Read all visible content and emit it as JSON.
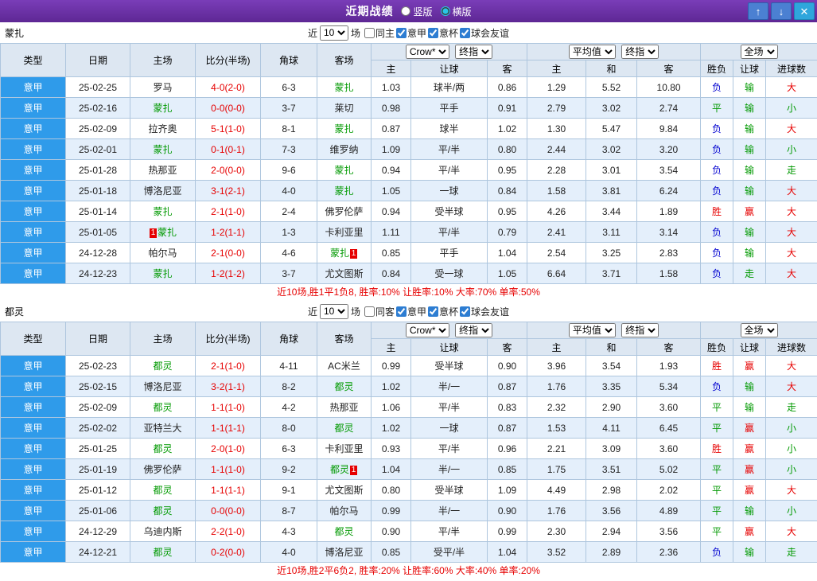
{
  "titlebar": {
    "title": "近期战绩",
    "layout_options": [
      {
        "label": "竖版",
        "selected": false
      },
      {
        "label": "横版",
        "selected": true
      }
    ],
    "up_icon": "↑",
    "down_icon": "↓",
    "close_icon": "✕"
  },
  "dropdowns": {
    "company": "Crow*",
    "final": "终指",
    "average": "平均值",
    "scope": "全场"
  },
  "filter_labels": {
    "near": "近",
    "games": "场"
  },
  "columns": {
    "type": "类型",
    "date": "日期",
    "home": "主场",
    "score": "比分(半场)",
    "corner": "角球",
    "away": "客场",
    "h": "主",
    "handicap": "让球",
    "a": "客",
    "h2": "主",
    "d": "和",
    "a2": "客",
    "result": "胜负",
    "rq": "让球",
    "goals": "进球数"
  },
  "result_color_map": {
    "胜": "red",
    "赢": "red",
    "大": "red",
    "平": "green",
    "输": "green",
    "小": "green",
    "走": "green",
    "负": "blue"
  },
  "colors": {
    "accent_blue": "#2f9bea",
    "title_purple": "#6a2fa9",
    "positive_red": "#e60000",
    "negative_green": "#009900",
    "draw_blue": "#0000d0"
  },
  "sections": [
    {
      "team": "蒙扎",
      "filter": {
        "count": "10",
        "checkboxes": [
          {
            "label": "同主",
            "checked": false
          },
          {
            "label": "意甲",
            "checked": true
          },
          {
            "label": "意杯",
            "checked": true
          },
          {
            "label": "球会友谊",
            "checked": true
          }
        ]
      },
      "rows": [
        {
          "league": "意甲",
          "date": "25-02-25",
          "home": "罗马",
          "score": "4-0(2-0)",
          "corner": "6-3",
          "away": "蒙扎",
          "away_team": true,
          "o1": "1.03",
          "handicap": "球半/两",
          "o2": "0.86",
          "e1": "1.29",
          "e2": "5.52",
          "e3": "10.80",
          "r1": "负",
          "r2": "输",
          "r3": "大"
        },
        {
          "league": "意甲",
          "date": "25-02-16",
          "home": "蒙扎",
          "home_team": true,
          "score": "0-0(0-0)",
          "corner": "3-7",
          "away": "莱切",
          "o1": "0.98",
          "handicap": "平手",
          "o2": "0.91",
          "e1": "2.79",
          "e2": "3.02",
          "e3": "2.74",
          "r1": "平",
          "r2": "输",
          "r3": "小"
        },
        {
          "league": "意甲",
          "date": "25-02-09",
          "home": "拉齐奥",
          "score": "5-1(1-0)",
          "corner": "8-1",
          "away": "蒙扎",
          "away_team": true,
          "o1": "0.87",
          "handicap": "球半",
          "o2": "1.02",
          "e1": "1.30",
          "e2": "5.47",
          "e3": "9.84",
          "r1": "负",
          "r2": "输",
          "r3": "大"
        },
        {
          "league": "意甲",
          "date": "25-02-01",
          "home": "蒙扎",
          "home_team": true,
          "score": "0-1(0-1)",
          "corner": "7-3",
          "away": "维罗纳",
          "o1": "1.09",
          "handicap": "平/半",
          "o2": "0.80",
          "e1": "2.44",
          "e2": "3.02",
          "e3": "3.20",
          "r1": "负",
          "r2": "输",
          "r3": "小"
        },
        {
          "league": "意甲",
          "date": "25-01-28",
          "home": "热那亚",
          "score": "2-0(0-0)",
          "corner": "9-6",
          "away": "蒙扎",
          "away_team": true,
          "o1": "0.94",
          "handicap": "平/半",
          "o2": "0.95",
          "e1": "2.28",
          "e2": "3.01",
          "e3": "3.54",
          "r1": "负",
          "r2": "输",
          "r3": "走"
        },
        {
          "league": "意甲",
          "date": "25-01-18",
          "home": "博洛尼亚",
          "score": "3-1(2-1)",
          "corner": "4-0",
          "away": "蒙扎",
          "away_team": true,
          "o1": "1.05",
          "handicap": "一球",
          "o2": "0.84",
          "e1": "1.58",
          "e2": "3.81",
          "e3": "6.24",
          "r1": "负",
          "r2": "输",
          "r3": "大"
        },
        {
          "league": "意甲",
          "date": "25-01-14",
          "home": "蒙扎",
          "home_team": true,
          "score": "2-1(1-0)",
          "corner": "2-4",
          "away": "佛罗伦萨",
          "o1": "0.94",
          "handicap": "受半球",
          "o2": "0.95",
          "e1": "4.26",
          "e2": "3.44",
          "e3": "1.89",
          "r1": "胜",
          "r2": "赢",
          "r3": "大"
        },
        {
          "league": "意甲",
          "date": "25-01-05",
          "home": "蒙扎",
          "home_team": true,
          "home_card": "1",
          "home_card_side": "left",
          "score": "1-2(1-1)",
          "corner": "1-3",
          "away": "卡利亚里",
          "o1": "1.11",
          "handicap": "平/半",
          "o2": "0.79",
          "e1": "2.41",
          "e2": "3.11",
          "e3": "3.14",
          "r1": "负",
          "r2": "输",
          "r3": "大"
        },
        {
          "league": "意甲",
          "date": "24-12-28",
          "home": "帕尔马",
          "score": "2-1(0-0)",
          "corner": "4-6",
          "away": "蒙扎",
          "away_team": true,
          "away_card": "1",
          "away_card_side": "right",
          "o1": "0.85",
          "handicap": "平手",
          "o2": "1.04",
          "e1": "2.54",
          "e2": "3.25",
          "e3": "2.83",
          "r1": "负",
          "r2": "输",
          "r3": "大"
        },
        {
          "league": "意甲",
          "date": "24-12-23",
          "home": "蒙扎",
          "home_team": true,
          "score": "1-2(1-2)",
          "corner": "3-7",
          "away": "尤文图斯",
          "o1": "0.84",
          "handicap": "受一球",
          "o2": "1.05",
          "e1": "6.64",
          "e2": "3.71",
          "e3": "1.58",
          "r1": "负",
          "r2": "走",
          "r3": "大"
        }
      ],
      "summary": "近10场,胜1平1负8, 胜率:10% 让胜率:10% 大率:70% 单率:50%"
    },
    {
      "team": "都灵",
      "filter": {
        "count": "10",
        "checkboxes": [
          {
            "label": "同客",
            "checked": false
          },
          {
            "label": "意甲",
            "checked": true
          },
          {
            "label": "意杯",
            "checked": true
          },
          {
            "label": "球会友谊",
            "checked": true
          }
        ]
      },
      "rows": [
        {
          "league": "意甲",
          "date": "25-02-23",
          "home": "都灵",
          "home_team": true,
          "score": "2-1(1-0)",
          "corner": "4-11",
          "away": "AC米兰",
          "o1": "0.99",
          "handicap": "受半球",
          "o2": "0.90",
          "e1": "3.96",
          "e2": "3.54",
          "e3": "1.93",
          "r1": "胜",
          "r2": "赢",
          "r3": "大"
        },
        {
          "league": "意甲",
          "date": "25-02-15",
          "home": "博洛尼亚",
          "score": "3-2(1-1)",
          "corner": "8-2",
          "away": "都灵",
          "away_team": true,
          "o1": "1.02",
          "handicap": "半/一",
          "o2": "0.87",
          "e1": "1.76",
          "e2": "3.35",
          "e3": "5.34",
          "r1": "负",
          "r2": "输",
          "r3": "大"
        },
        {
          "league": "意甲",
          "date": "25-02-09",
          "home": "都灵",
          "home_team": true,
          "score": "1-1(1-0)",
          "corner": "4-2",
          "away": "热那亚",
          "o1": "1.06",
          "handicap": "平/半",
          "o2": "0.83",
          "e1": "2.32",
          "e2": "2.90",
          "e3": "3.60",
          "r1": "平",
          "r2": "输",
          "r3": "走"
        },
        {
          "league": "意甲",
          "date": "25-02-02",
          "home": "亚特兰大",
          "score": "1-1(1-1)",
          "corner": "8-0",
          "away": "都灵",
          "away_team": true,
          "o1": "1.02",
          "handicap": "一球",
          "o2": "0.87",
          "e1": "1.53",
          "e2": "4.11",
          "e3": "6.45",
          "r1": "平",
          "r2": "赢",
          "r3": "小"
        },
        {
          "league": "意甲",
          "date": "25-01-25",
          "home": "都灵",
          "home_team": true,
          "score": "2-0(1-0)",
          "corner": "6-3",
          "away": "卡利亚里",
          "o1": "0.93",
          "handicap": "平/半",
          "o2": "0.96",
          "e1": "2.21",
          "e2": "3.09",
          "e3": "3.60",
          "r1": "胜",
          "r2": "赢",
          "r3": "小"
        },
        {
          "league": "意甲",
          "date": "25-01-19",
          "home": "佛罗伦萨",
          "score": "1-1(1-0)",
          "corner": "9-2",
          "away": "都灵",
          "away_team": true,
          "away_card": "1",
          "away_card_side": "right",
          "o1": "1.04",
          "handicap": "半/一",
          "o2": "0.85",
          "e1": "1.75",
          "e2": "3.51",
          "e3": "5.02",
          "r1": "平",
          "r2": "赢",
          "r3": "小"
        },
        {
          "league": "意甲",
          "date": "25-01-12",
          "home": "都灵",
          "home_team": true,
          "score": "1-1(1-1)",
          "corner": "9-1",
          "away": "尤文图斯",
          "o1": "0.80",
          "handicap": "受半球",
          "o2": "1.09",
          "e1": "4.49",
          "e2": "2.98",
          "e3": "2.02",
          "r1": "平",
          "r2": "赢",
          "r3": "大"
        },
        {
          "league": "意甲",
          "date": "25-01-06",
          "home": "都灵",
          "home_team": true,
          "score": "0-0(0-0)",
          "corner": "8-7",
          "away": "帕尔马",
          "o1": "0.99",
          "handicap": "半/一",
          "o2": "0.90",
          "e1": "1.76",
          "e2": "3.56",
          "e3": "4.89",
          "r1": "平",
          "r2": "输",
          "r3": "小"
        },
        {
          "league": "意甲",
          "date": "24-12-29",
          "home": "乌迪内斯",
          "score": "2-2(1-0)",
          "corner": "4-3",
          "away": "都灵",
          "away_team": true,
          "o1": "0.90",
          "handicap": "平/半",
          "o2": "0.99",
          "e1": "2.30",
          "e2": "2.94",
          "e3": "3.56",
          "r1": "平",
          "r2": "赢",
          "r3": "大"
        },
        {
          "league": "意甲",
          "date": "24-12-21",
          "home": "都灵",
          "home_team": true,
          "score": "0-2(0-0)",
          "corner": "4-0",
          "away": "博洛尼亚",
          "o1": "0.85",
          "handicap": "受平/半",
          "o2": "1.04",
          "e1": "3.52",
          "e2": "2.89",
          "e3": "2.36",
          "r1": "负",
          "r2": "输",
          "r3": "走"
        }
      ],
      "summary": "近10场,胜2平6负2, 胜率:20% 让胜率:60% 大率:40% 单率:20%"
    }
  ]
}
